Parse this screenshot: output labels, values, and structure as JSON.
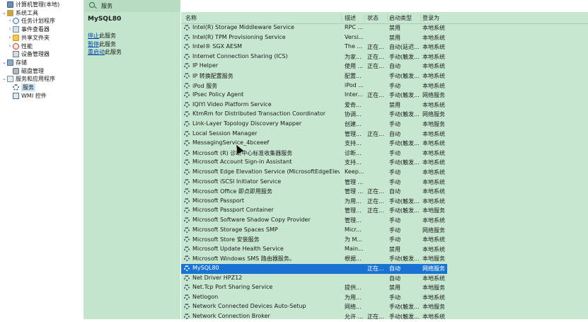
{
  "tree": {
    "items": [
      {
        "label": "计算机管理(本地)",
        "icon": "computer-icon",
        "expander": ""
      },
      {
        "label": "系统工具",
        "icon": "tools-icon",
        "expander": "⌄"
      },
      {
        "label": "任务计划程序",
        "icon": "clock-icon",
        "expander": "›"
      },
      {
        "label": "事件查看器",
        "icon": "event-viewer-icon",
        "expander": "›"
      },
      {
        "label": "共享文件夹",
        "icon": "folder-icon",
        "expander": "›"
      },
      {
        "label": "性能",
        "icon": "performance-icon",
        "expander": "›"
      },
      {
        "label": "设备管理器",
        "icon": "device-manager-icon",
        "expander": ""
      },
      {
        "label": "存储",
        "icon": "storage-icon",
        "expander": "⌄"
      },
      {
        "label": "磁盘管理",
        "icon": "disk-icon",
        "expander": ""
      },
      {
        "label": "服务和应用程序",
        "icon": "services-apps-icon",
        "expander": "⌄"
      },
      {
        "label": "服务",
        "icon": "gear-icon",
        "expander": "",
        "selected": true
      },
      {
        "label": "WMI 控件",
        "icon": "wmi-icon",
        "expander": ""
      }
    ]
  },
  "ext": {
    "header_title": "服务",
    "service_name": "MySQL80",
    "actions": [
      {
        "link": "停止",
        "suffix": "此服务"
      },
      {
        "link": "暂停",
        "suffix": "此服务"
      },
      {
        "link": "重启动",
        "suffix": "此服务"
      }
    ]
  },
  "columns": {
    "name": "名称",
    "desc": "描述",
    "status": "状态",
    "startup": "启动类型",
    "logon": "登录为"
  },
  "services": [
    {
      "name": "Intel(R) Storage Middleware Service",
      "desc": "RPC ...",
      "status": "",
      "startup": "禁用",
      "logon": "本地系统"
    },
    {
      "name": "Intel(R) TPM Provisioning Service",
      "desc": "Versi...",
      "status": "",
      "startup": "禁用",
      "logon": "本地系统"
    },
    {
      "name": "Intel® SGX AESM",
      "desc": "The ...",
      "status": "正在...",
      "startup": "自动(延迟...",
      "logon": "本地系统"
    },
    {
      "name": "Internet Connection Sharing (ICS)",
      "desc": "为家...",
      "status": "正在...",
      "startup": "手动(触发...",
      "logon": "本地系统"
    },
    {
      "name": "IP Helper",
      "desc": "使用 ...",
      "status": "正在...",
      "startup": "自动",
      "logon": "本地系统"
    },
    {
      "name": "IP 转换配置服务",
      "desc": "配置...",
      "status": "",
      "startup": "手动(触发...",
      "logon": "本地系统"
    },
    {
      "name": "iPod 服务",
      "desc": "iPod ...",
      "status": "",
      "startup": "手动",
      "logon": "本地系统"
    },
    {
      "name": "IPsec Policy Agent",
      "desc": "Inter...",
      "status": "正在...",
      "startup": "手动(触发...",
      "logon": "网络服务"
    },
    {
      "name": "IQIYI Video Platform Service",
      "desc": "爱奇...",
      "status": "",
      "startup": "禁用",
      "logon": "本地系统"
    },
    {
      "name": "KtmRm for Distributed Transaction Coordinator",
      "desc": "协调...",
      "status": "",
      "startup": "手动(触发...",
      "logon": "网络服务"
    },
    {
      "name": "Link-Layer Topology Discovery Mapper",
      "desc": "创建...",
      "status": "",
      "startup": "手动",
      "logon": "本地服务"
    },
    {
      "name": "Local Session Manager",
      "desc": "管理...",
      "status": "正在...",
      "startup": "自动",
      "logon": "本地系统"
    },
    {
      "name": "MessagingService_4bceeef",
      "desc": "支持...",
      "status": "",
      "startup": "手动(触发...",
      "logon": "本地系统"
    },
    {
      "name": "Microsoft (R) 诊断中心标准收集器服务",
      "desc": "诊断...",
      "status": "",
      "startup": "手动",
      "logon": "本地系统"
    },
    {
      "name": "Microsoft Account Sign-in Assistant",
      "desc": "支持...",
      "status": "",
      "startup": "手动(触发...",
      "logon": "本地系统"
    },
    {
      "name": "Microsoft Edge Elevation Service (MicrosoftEdgeElevation...",
      "desc": "Keep...",
      "status": "",
      "startup": "手动",
      "logon": "本地系统"
    },
    {
      "name": "Microsoft iSCSI Initiator Service",
      "desc": "管理 ...",
      "status": "",
      "startup": "手动",
      "logon": "本地系统"
    },
    {
      "name": "Microsoft Office 即点即用服务",
      "desc": "管理 ...",
      "status": "正在...",
      "startup": "自动",
      "logon": "本地系统"
    },
    {
      "name": "Microsoft Passport",
      "desc": "为用...",
      "status": "正在...",
      "startup": "手动(触发...",
      "logon": "本地系统"
    },
    {
      "name": "Microsoft Passport Container",
      "desc": "管理...",
      "status": "正在...",
      "startup": "手动(触发...",
      "logon": "本地服务"
    },
    {
      "name": "Microsoft Software Shadow Copy Provider",
      "desc": "管理...",
      "status": "",
      "startup": "手动",
      "logon": "本地系统"
    },
    {
      "name": "Microsoft Storage Spaces SMP",
      "desc": "Micr...",
      "status": "",
      "startup": "手动",
      "logon": "网络服务"
    },
    {
      "name": "Microsoft Store 安装服务",
      "desc": "为 M...",
      "status": "",
      "startup": "手动",
      "logon": "本地系统"
    },
    {
      "name": "Microsoft Update Health Service",
      "desc": "Main...",
      "status": "",
      "startup": "禁用",
      "logon": "本地系统"
    },
    {
      "name": "Microsoft Windows SMS 路由器服务。",
      "desc": "根据...",
      "status": "",
      "startup": "手动(触发...",
      "logon": "本地服务"
    },
    {
      "name": "MySQL80",
      "desc": "",
      "status": "正在...",
      "startup": "自动",
      "logon": "网络服务",
      "selected": true
    },
    {
      "name": "Net Driver HPZ12",
      "desc": "",
      "status": "",
      "startup": "自动",
      "logon": "本地系统"
    },
    {
      "name": "Net.Tcp Port Sharing Service",
      "desc": "提供...",
      "status": "",
      "startup": "禁用",
      "logon": "本地服务"
    },
    {
      "name": "Netlogon",
      "desc": "为用...",
      "status": "",
      "startup": "手动",
      "logon": "本地系统"
    },
    {
      "name": "Network Connected Devices Auto-Setup",
      "desc": "网络...",
      "status": "",
      "startup": "手动(触发...",
      "logon": "本地服务"
    },
    {
      "name": "Network Connection Broker",
      "desc": "允许 ...",
      "status": "正在...",
      "startup": "手动(触发...",
      "logon": "本地系统"
    }
  ]
}
